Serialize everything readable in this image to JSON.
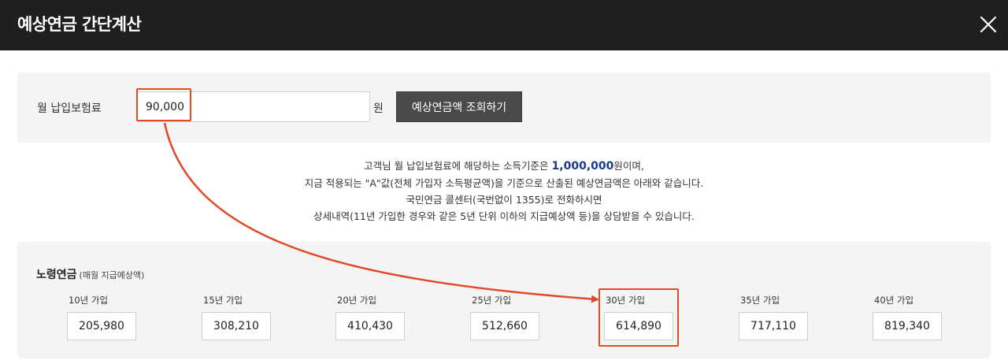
{
  "header": {
    "title": "예상연금 간단계산",
    "close_icon": "close-icon"
  },
  "input_panel": {
    "label": "월 납입보험료",
    "fee_value": "90,000",
    "unit": "원",
    "lookup_button": "예상연금액 조회하기"
  },
  "info": {
    "line1_prefix": "고객님 월 납입보험료에 해당하는 소득기준은 ",
    "line1_amount": "1,000,000",
    "line1_suffix": "원이며,",
    "line2": "지금 적용되는 \"A\"값(전체 가입자 소득평균액)을 기준으로 산출된 예상연금액은 아래와 같습니다.",
    "line3": "국민연금 콜센터(국번없이 1355)로 전화하시면",
    "line4": "상세내역(11년 가입한 경우와 같은 5년 단위 이하의 지급예상액 등)을 상담받을 수 있습니다."
  },
  "result": {
    "title": "노령연금",
    "subtitle": "(매월 지급예상액)",
    "periods": [
      {
        "label": "10년 가입",
        "value": "205,980"
      },
      {
        "label": "15년 가입",
        "value": "308,210"
      },
      {
        "label": "20년 가입",
        "value": "410,430"
      },
      {
        "label": "25년 가입",
        "value": "512,660"
      },
      {
        "label": "30년 가입",
        "value": "614,890"
      },
      {
        "label": "35년 가입",
        "value": "717,110"
      },
      {
        "label": "40년 가입",
        "value": "819,340"
      }
    ]
  },
  "colors": {
    "header_bg": "#1f1f1f",
    "annotation": "#e24a26",
    "amount_highlight": "#1a3a8a",
    "button_bg": "#4a4a4a"
  }
}
